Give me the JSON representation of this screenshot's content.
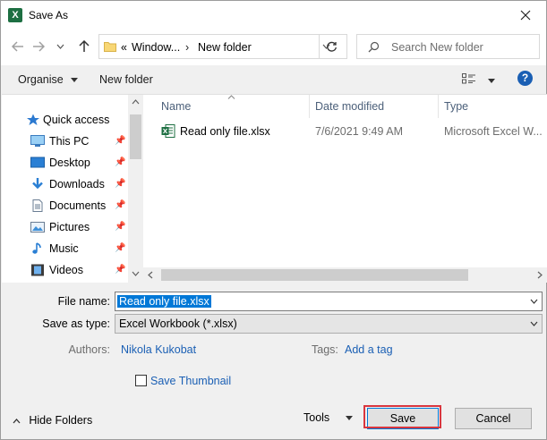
{
  "window": {
    "title": "Save As",
    "app_icon": "excel-icon"
  },
  "nav": {
    "address_segments": [
      "Window...",
      "New folder"
    ],
    "address_prefix": "«",
    "search_placeholder": "Search New folder"
  },
  "toolbar": {
    "organise": "Organise",
    "new_folder": "New folder",
    "help": "?"
  },
  "sidebar": {
    "items": [
      {
        "label": "Quick access",
        "icon": "star-icon",
        "pinned": false
      },
      {
        "label": "This PC",
        "icon": "pc-icon",
        "pinned": true
      },
      {
        "label": "Desktop",
        "icon": "desktop-icon",
        "pinned": true
      },
      {
        "label": "Downloads",
        "icon": "download-icon",
        "pinned": true
      },
      {
        "label": "Documents",
        "icon": "documents-icon",
        "pinned": true
      },
      {
        "label": "Pictures",
        "icon": "pictures-icon",
        "pinned": true
      },
      {
        "label": "Music",
        "icon": "music-icon",
        "pinned": true
      },
      {
        "label": "Videos",
        "icon": "videos-icon",
        "pinned": true
      }
    ]
  },
  "files": {
    "columns": [
      "Name",
      "Date modified",
      "Type"
    ],
    "rows": [
      {
        "name": "Read only file.xlsx",
        "date": "7/6/2021 9:49 AM",
        "type": "Microsoft Excel W..."
      }
    ]
  },
  "form": {
    "file_name_label": "File name:",
    "file_name_value": "Read only file.xlsx",
    "save_type_label": "Save as type:",
    "save_type_value": "Excel Workbook (*.xlsx)",
    "authors_label": "Authors:",
    "authors_value": "Nikola Kukobat",
    "tags_label": "Tags:",
    "tags_value": "Add a tag",
    "thumbnail_label": "Save Thumbnail",
    "thumbnail_checked": false
  },
  "footer": {
    "hide_folders": "Hide Folders",
    "tools": "Tools",
    "save": "Save",
    "cancel": "Cancel"
  },
  "colors": {
    "accent": "#0078d7",
    "highlight_border": "#d9363e",
    "excel": "#1d6f42"
  }
}
